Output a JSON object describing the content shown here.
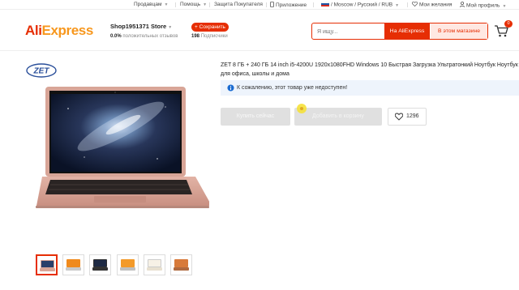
{
  "topbar": {
    "sellers": "Продавцам",
    "help": "Помощь",
    "buyer_protection": "Защита Покупателя",
    "app": "Приложение",
    "locale": "/ Moscow / Русский /  RUB",
    "wishlist": "Мои желания",
    "profile": "Мой профиль"
  },
  "header": {
    "logo_ali": "Ali",
    "logo_express": "Express",
    "store_name": "Shop1951371 Store",
    "store_rating_value": "0.0%",
    "store_rating_label": "положительных отзывов",
    "save_label": "+ Сохранить",
    "subscribers_value": "198",
    "subscribers_label": "Подписчики",
    "search_placeholder": "Я ищу...",
    "search_aliexpress": "На AliExpress",
    "search_store": "В этом магазине",
    "cart_count": "0"
  },
  "product": {
    "brand_logo": "ZET",
    "title": "ZET 8 ГБ + 240 ГБ 14 inch i5-4200U 1920x1080FHD Windows 10 Быстрая Загрузка Ультратонкий Ноутбук Ноутбук для офиса, школы и дома",
    "notice": "К сожалению, этот товар уже недоступен!",
    "buy_now": "Купить сейчас",
    "add_to_cart": "Добавить в корзину",
    "wishlist_count": "1296"
  },
  "thumbnails": [
    {
      "icon": "laptop-rose-thumbnail",
      "active": true
    },
    {
      "icon": "laptop-orange-thumbnail"
    },
    {
      "icon": "laptop-black-thumbnail"
    },
    {
      "icon": "laptop-orange-thumbnail"
    },
    {
      "icon": "laptop-white-thumbnail"
    },
    {
      "icon": "laptop-orange-thumbnail"
    }
  ],
  "colors": {
    "brand_red": "#e62e04",
    "brand_orange": "#f7971d",
    "laptop_rose": "#d9a597",
    "disabled_button": "#e0e0e0",
    "notice_bg": "#eef4fc"
  }
}
